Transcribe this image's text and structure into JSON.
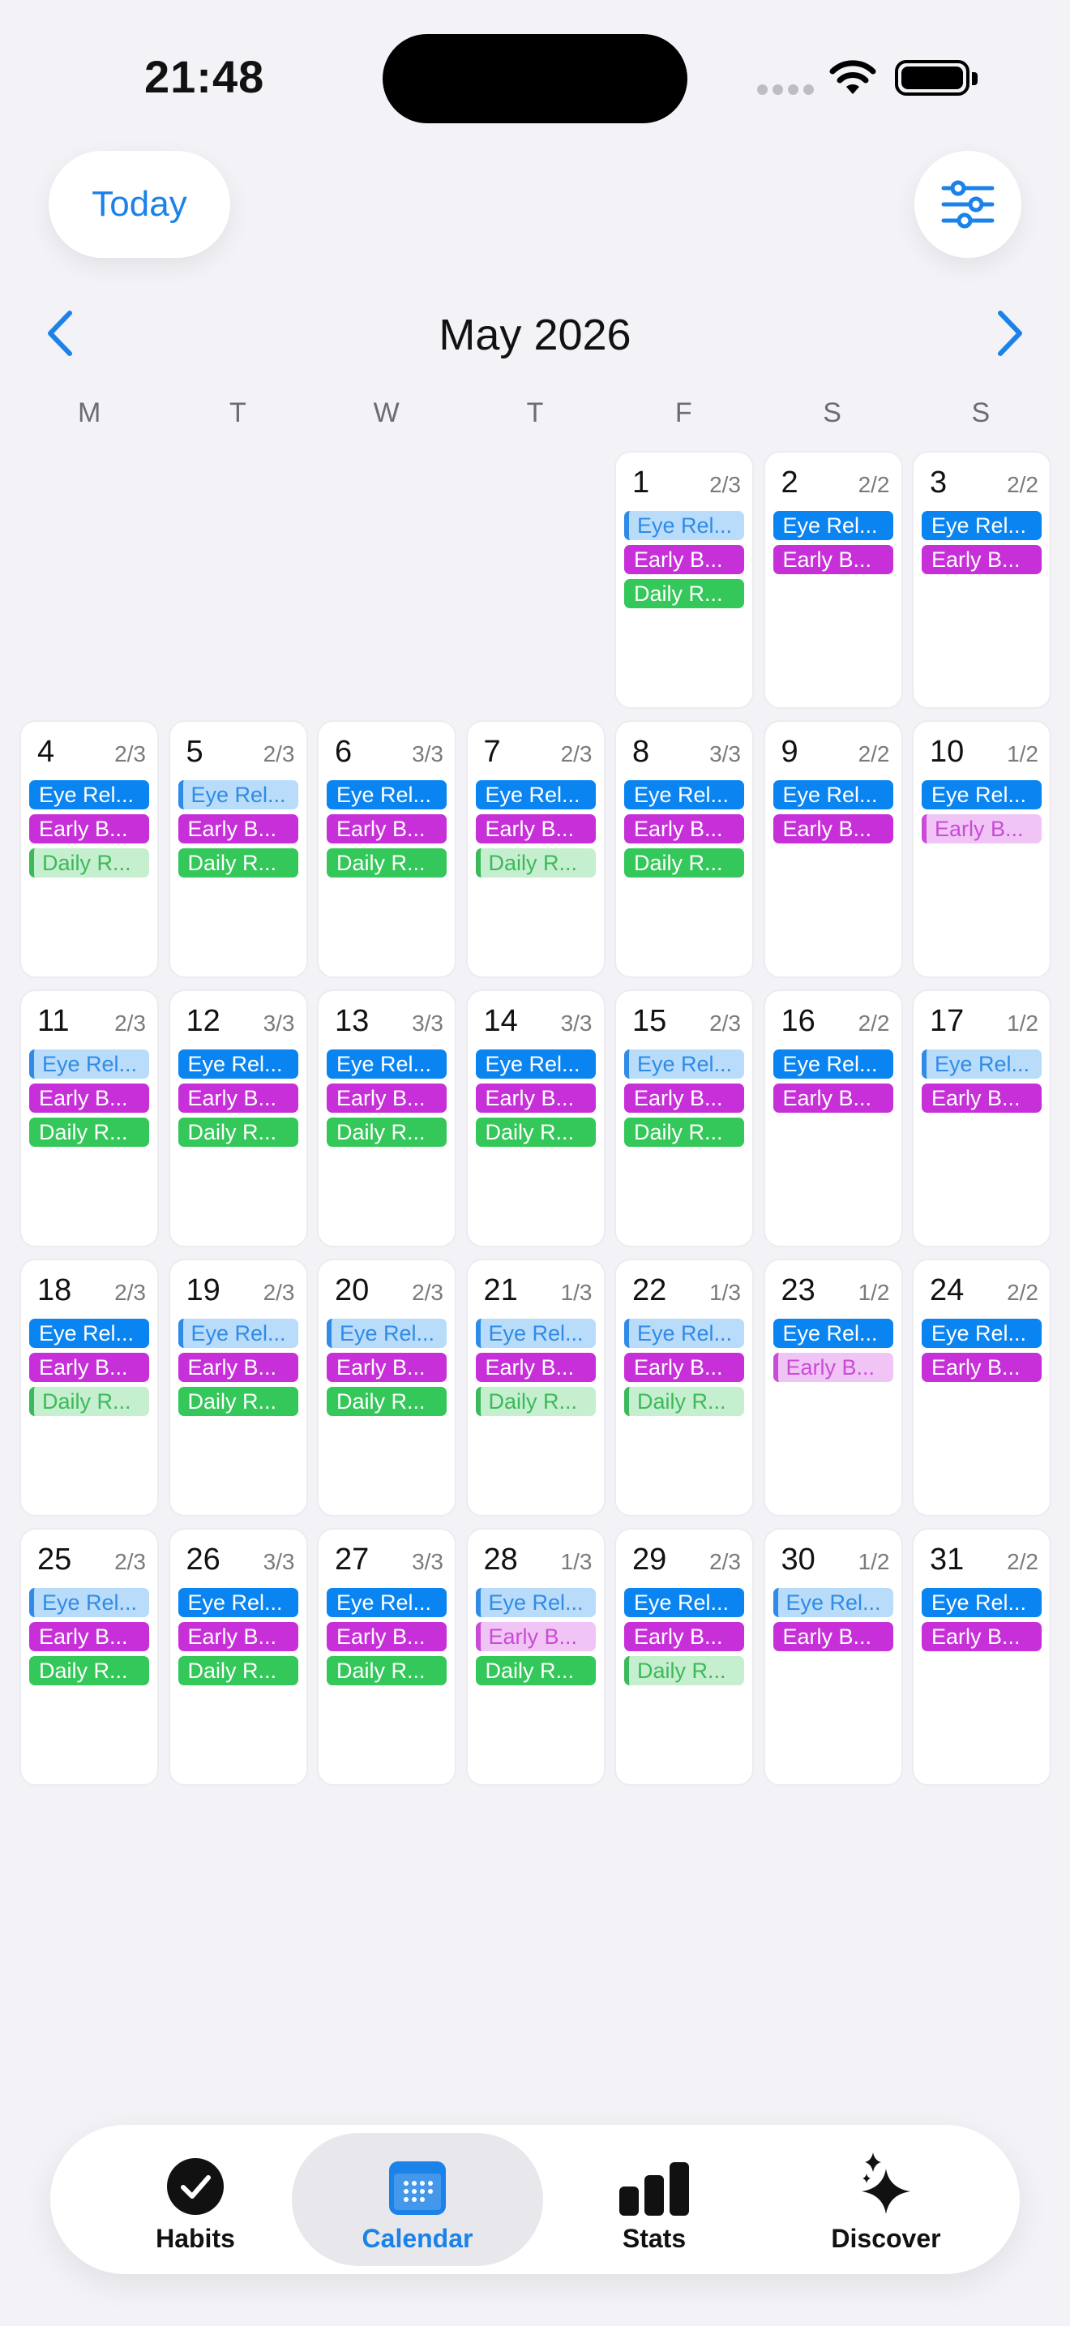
{
  "status": {
    "time": "21:48"
  },
  "header": {
    "today_label": "Today"
  },
  "calendar": {
    "month_title": "May 2026",
    "weekdays": [
      "M",
      "T",
      "W",
      "T",
      "F",
      "S",
      "S"
    ],
    "leading_blanks": 4,
    "days": [
      {
        "day": "1",
        "count": "2/3",
        "habits": [
          {
            "label": "Eye Rel...",
            "color": "blue",
            "done": false
          },
          {
            "label": "Early B...",
            "color": "purple",
            "done": true
          },
          {
            "label": "Daily R...",
            "color": "green",
            "done": true
          }
        ]
      },
      {
        "day": "2",
        "count": "2/2",
        "habits": [
          {
            "label": "Eye Rel...",
            "color": "blue",
            "done": true
          },
          {
            "label": "Early B...",
            "color": "purple",
            "done": true
          }
        ]
      },
      {
        "day": "3",
        "count": "2/2",
        "habits": [
          {
            "label": "Eye Rel...",
            "color": "blue",
            "done": true
          },
          {
            "label": "Early B...",
            "color": "purple",
            "done": true
          }
        ]
      },
      {
        "day": "4",
        "count": "2/3",
        "habits": [
          {
            "label": "Eye Rel...",
            "color": "blue",
            "done": true
          },
          {
            "label": "Early B...",
            "color": "purple",
            "done": true
          },
          {
            "label": "Daily R...",
            "color": "green",
            "done": false
          }
        ]
      },
      {
        "day": "5",
        "count": "2/3",
        "habits": [
          {
            "label": "Eye Rel...",
            "color": "blue",
            "done": false
          },
          {
            "label": "Early B...",
            "color": "purple",
            "done": true
          },
          {
            "label": "Daily R...",
            "color": "green",
            "done": true
          }
        ]
      },
      {
        "day": "6",
        "count": "3/3",
        "habits": [
          {
            "label": "Eye Rel...",
            "color": "blue",
            "done": true
          },
          {
            "label": "Early B...",
            "color": "purple",
            "done": true
          },
          {
            "label": "Daily R...",
            "color": "green",
            "done": true
          }
        ]
      },
      {
        "day": "7",
        "count": "2/3",
        "habits": [
          {
            "label": "Eye Rel...",
            "color": "blue",
            "done": true
          },
          {
            "label": "Early B...",
            "color": "purple",
            "done": true
          },
          {
            "label": "Daily R...",
            "color": "green",
            "done": false
          }
        ]
      },
      {
        "day": "8",
        "count": "3/3",
        "habits": [
          {
            "label": "Eye Rel...",
            "color": "blue",
            "done": true
          },
          {
            "label": "Early B...",
            "color": "purple",
            "done": true
          },
          {
            "label": "Daily R...",
            "color": "green",
            "done": true
          }
        ]
      },
      {
        "day": "9",
        "count": "2/2",
        "habits": [
          {
            "label": "Eye Rel...",
            "color": "blue",
            "done": true
          },
          {
            "label": "Early B...",
            "color": "purple",
            "done": true
          }
        ]
      },
      {
        "day": "10",
        "count": "1/2",
        "habits": [
          {
            "label": "Eye Rel...",
            "color": "blue",
            "done": true
          },
          {
            "label": "Early B...",
            "color": "purple",
            "done": false
          }
        ]
      },
      {
        "day": "11",
        "count": "2/3",
        "habits": [
          {
            "label": "Eye Rel...",
            "color": "blue",
            "done": false
          },
          {
            "label": "Early B...",
            "color": "purple",
            "done": true
          },
          {
            "label": "Daily R...",
            "color": "green",
            "done": true
          }
        ]
      },
      {
        "day": "12",
        "count": "3/3",
        "habits": [
          {
            "label": "Eye Rel...",
            "color": "blue",
            "done": true
          },
          {
            "label": "Early B...",
            "color": "purple",
            "done": true
          },
          {
            "label": "Daily R...",
            "color": "green",
            "done": true
          }
        ]
      },
      {
        "day": "13",
        "count": "3/3",
        "habits": [
          {
            "label": "Eye Rel...",
            "color": "blue",
            "done": true
          },
          {
            "label": "Early B...",
            "color": "purple",
            "done": true
          },
          {
            "label": "Daily R...",
            "color": "green",
            "done": true
          }
        ]
      },
      {
        "day": "14",
        "count": "3/3",
        "habits": [
          {
            "label": "Eye Rel...",
            "color": "blue",
            "done": true
          },
          {
            "label": "Early B...",
            "color": "purple",
            "done": true
          },
          {
            "label": "Daily R...",
            "color": "green",
            "done": true
          }
        ]
      },
      {
        "day": "15",
        "count": "2/3",
        "habits": [
          {
            "label": "Eye Rel...",
            "color": "blue",
            "done": false
          },
          {
            "label": "Early B...",
            "color": "purple",
            "done": true
          },
          {
            "label": "Daily R...",
            "color": "green",
            "done": true
          }
        ]
      },
      {
        "day": "16",
        "count": "2/2",
        "habits": [
          {
            "label": "Eye Rel...",
            "color": "blue",
            "done": true
          },
          {
            "label": "Early B...",
            "color": "purple",
            "done": true
          }
        ]
      },
      {
        "day": "17",
        "count": "1/2",
        "habits": [
          {
            "label": "Eye Rel...",
            "color": "blue",
            "done": false
          },
          {
            "label": "Early B...",
            "color": "purple",
            "done": true
          }
        ]
      },
      {
        "day": "18",
        "count": "2/3",
        "habits": [
          {
            "label": "Eye Rel...",
            "color": "blue",
            "done": true
          },
          {
            "label": "Early B...",
            "color": "purple",
            "done": true
          },
          {
            "label": "Daily R...",
            "color": "green",
            "done": false
          }
        ]
      },
      {
        "day": "19",
        "count": "2/3",
        "habits": [
          {
            "label": "Eye Rel...",
            "color": "blue",
            "done": false
          },
          {
            "label": "Early B...",
            "color": "purple",
            "done": true
          },
          {
            "label": "Daily R...",
            "color": "green",
            "done": true
          }
        ]
      },
      {
        "day": "20",
        "count": "2/3",
        "habits": [
          {
            "label": "Eye Rel...",
            "color": "blue",
            "done": false
          },
          {
            "label": "Early B...",
            "color": "purple",
            "done": true
          },
          {
            "label": "Daily R...",
            "color": "green",
            "done": true
          }
        ]
      },
      {
        "day": "21",
        "count": "1/3",
        "habits": [
          {
            "label": "Eye Rel...",
            "color": "blue",
            "done": false
          },
          {
            "label": "Early B...",
            "color": "purple",
            "done": true
          },
          {
            "label": "Daily R...",
            "color": "green",
            "done": false
          }
        ]
      },
      {
        "day": "22",
        "count": "1/3",
        "habits": [
          {
            "label": "Eye Rel...",
            "color": "blue",
            "done": false
          },
          {
            "label": "Early B...",
            "color": "purple",
            "done": true
          },
          {
            "label": "Daily R...",
            "color": "green",
            "done": false
          }
        ]
      },
      {
        "day": "23",
        "count": "1/2",
        "habits": [
          {
            "label": "Eye Rel...",
            "color": "blue",
            "done": true
          },
          {
            "label": "Early B...",
            "color": "purple",
            "done": false
          }
        ]
      },
      {
        "day": "24",
        "count": "2/2",
        "habits": [
          {
            "label": "Eye Rel...",
            "color": "blue",
            "done": true
          },
          {
            "label": "Early B...",
            "color": "purple",
            "done": true
          }
        ]
      },
      {
        "day": "25",
        "count": "2/3",
        "habits": [
          {
            "label": "Eye Rel...",
            "color": "blue",
            "done": false
          },
          {
            "label": "Early B...",
            "color": "purple",
            "done": true
          },
          {
            "label": "Daily R...",
            "color": "green",
            "done": true
          }
        ]
      },
      {
        "day": "26",
        "count": "3/3",
        "habits": [
          {
            "label": "Eye Rel...",
            "color": "blue",
            "done": true
          },
          {
            "label": "Early B...",
            "color": "purple",
            "done": true
          },
          {
            "label": "Daily R...",
            "color": "green",
            "done": true
          }
        ]
      },
      {
        "day": "27",
        "count": "3/3",
        "habits": [
          {
            "label": "Eye Rel...",
            "color": "blue",
            "done": true
          },
          {
            "label": "Early B...",
            "color": "purple",
            "done": true
          },
          {
            "label": "Daily R...",
            "color": "green",
            "done": true
          }
        ]
      },
      {
        "day": "28",
        "count": "1/3",
        "habits": [
          {
            "label": "Eye Rel...",
            "color": "blue",
            "done": false
          },
          {
            "label": "Early B...",
            "color": "purple",
            "done": false
          },
          {
            "label": "Daily R...",
            "color": "green",
            "done": true
          }
        ]
      },
      {
        "day": "29",
        "count": "2/3",
        "habits": [
          {
            "label": "Eye Rel...",
            "color": "blue",
            "done": true
          },
          {
            "label": "Early B...",
            "color": "purple",
            "done": true
          },
          {
            "label": "Daily R...",
            "color": "green",
            "done": false
          }
        ]
      },
      {
        "day": "30",
        "count": "1/2",
        "habits": [
          {
            "label": "Eye Rel...",
            "color": "blue",
            "done": false
          },
          {
            "label": "Early B...",
            "color": "purple",
            "done": true
          }
        ]
      },
      {
        "day": "31",
        "count": "2/2",
        "habits": [
          {
            "label": "Eye Rel...",
            "color": "blue",
            "done": true
          },
          {
            "label": "Early B...",
            "color": "purple",
            "done": true
          }
        ]
      }
    ]
  },
  "tabs": [
    {
      "label": "Habits",
      "icon": "checkmark-circle-icon",
      "active": false
    },
    {
      "label": "Calendar",
      "icon": "calendar-icon",
      "active": true
    },
    {
      "label": "Stats",
      "icon": "bar-chart-icon",
      "active": false
    },
    {
      "label": "Discover",
      "icon": "sparkles-icon",
      "active": false
    }
  ],
  "colors": {
    "accent": "#1a82e8",
    "habit_blue": "#0a84f0",
    "habit_purple": "#c730d8",
    "habit_green": "#34c759"
  }
}
